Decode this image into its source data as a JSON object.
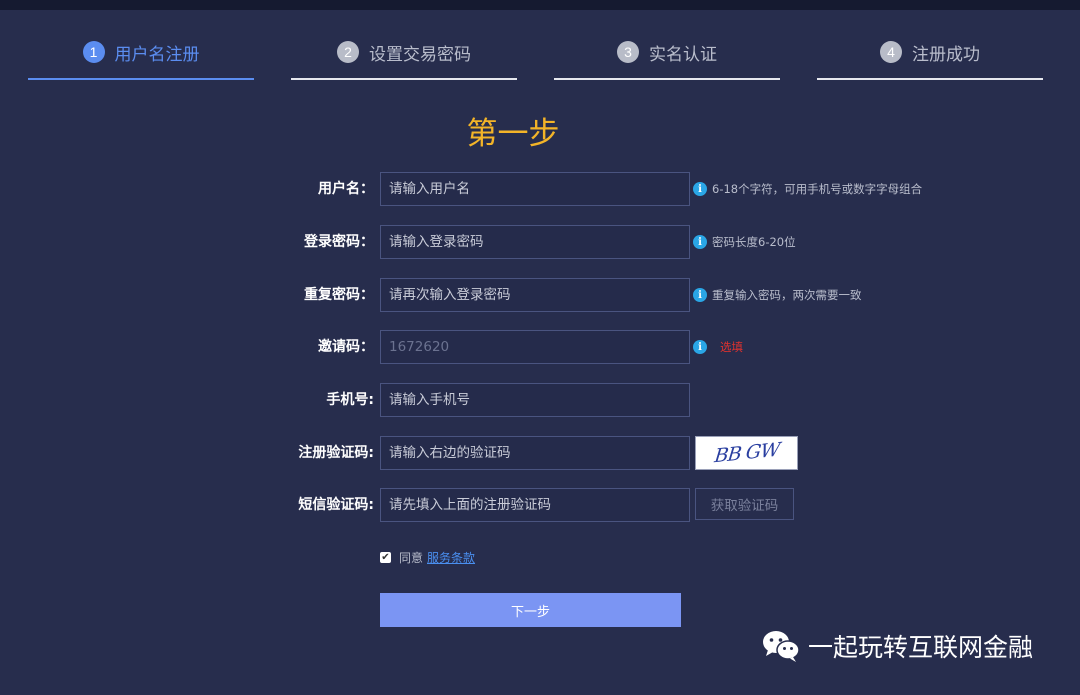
{
  "steps": [
    {
      "num": "1",
      "label": "用户名注册",
      "active": true
    },
    {
      "num": "2",
      "label": "设置交易密码",
      "active": false
    },
    {
      "num": "3",
      "label": "实名认证",
      "active": false
    },
    {
      "num": "4",
      "label": "注册成功",
      "active": false
    }
  ],
  "title": "第一步",
  "form": {
    "username": {
      "label": "用户名：",
      "placeholder": "请输入用户名",
      "hint": "6-18个字符，可用手机号或数字字母组合"
    },
    "password": {
      "label": "登录密码：",
      "placeholder": "请输入登录密码",
      "hint": "密码长度6-20位"
    },
    "confirm": {
      "label": "重复密码：",
      "placeholder": "请再次输入登录密码",
      "hint": "重复输入密码，两次需要一致"
    },
    "invite": {
      "label": "邀请码：",
      "value": "1672620",
      "hint": "选填"
    },
    "phone": {
      "label": "手机号:",
      "placeholder": "请输入手机号"
    },
    "captcha": {
      "label": "注册验证码:",
      "placeholder": "请输入右边的验证码",
      "image_text": "BB GW"
    },
    "sms": {
      "label": "短信验证码:",
      "placeholder": "请先填入上面的注册验证码",
      "button": "获取验证码"
    }
  },
  "agree": {
    "text": "同意",
    "link": "服务条款",
    "checked": true
  },
  "next_button": "下一步",
  "watermark": "一起玩转互联网金融",
  "colors": {
    "background": "#272d4d",
    "accent": "#5b8df0",
    "title": "#f3b428",
    "button": "#7b95f3",
    "hint_icon": "#2aa6e6",
    "optional": "#e0322e"
  }
}
